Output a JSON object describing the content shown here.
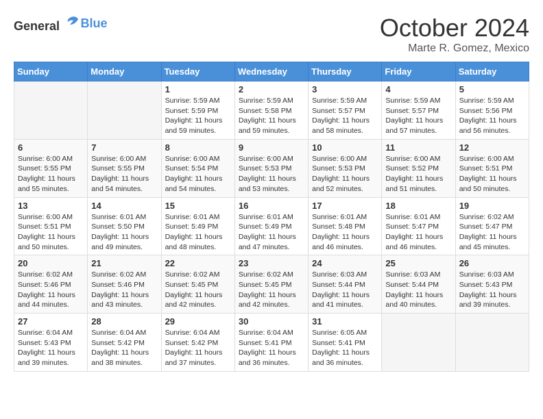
{
  "logo": {
    "general": "General",
    "blue": "Blue"
  },
  "title": {
    "month": "October 2024",
    "location": "Marte R. Gomez, Mexico"
  },
  "headers": [
    "Sunday",
    "Monday",
    "Tuesday",
    "Wednesday",
    "Thursday",
    "Friday",
    "Saturday"
  ],
  "weeks": [
    [
      {
        "day": "",
        "info": ""
      },
      {
        "day": "",
        "info": ""
      },
      {
        "day": "1",
        "info": "Sunrise: 5:59 AM\nSunset: 5:59 PM\nDaylight: 11 hours and 59 minutes."
      },
      {
        "day": "2",
        "info": "Sunrise: 5:59 AM\nSunset: 5:58 PM\nDaylight: 11 hours and 59 minutes."
      },
      {
        "day": "3",
        "info": "Sunrise: 5:59 AM\nSunset: 5:57 PM\nDaylight: 11 hours and 58 minutes."
      },
      {
        "day": "4",
        "info": "Sunrise: 5:59 AM\nSunset: 5:57 PM\nDaylight: 11 hours and 57 minutes."
      },
      {
        "day": "5",
        "info": "Sunrise: 5:59 AM\nSunset: 5:56 PM\nDaylight: 11 hours and 56 minutes."
      }
    ],
    [
      {
        "day": "6",
        "info": "Sunrise: 6:00 AM\nSunset: 5:55 PM\nDaylight: 11 hours and 55 minutes."
      },
      {
        "day": "7",
        "info": "Sunrise: 6:00 AM\nSunset: 5:55 PM\nDaylight: 11 hours and 54 minutes."
      },
      {
        "day": "8",
        "info": "Sunrise: 6:00 AM\nSunset: 5:54 PM\nDaylight: 11 hours and 54 minutes."
      },
      {
        "day": "9",
        "info": "Sunrise: 6:00 AM\nSunset: 5:53 PM\nDaylight: 11 hours and 53 minutes."
      },
      {
        "day": "10",
        "info": "Sunrise: 6:00 AM\nSunset: 5:53 PM\nDaylight: 11 hours and 52 minutes."
      },
      {
        "day": "11",
        "info": "Sunrise: 6:00 AM\nSunset: 5:52 PM\nDaylight: 11 hours and 51 minutes."
      },
      {
        "day": "12",
        "info": "Sunrise: 6:00 AM\nSunset: 5:51 PM\nDaylight: 11 hours and 50 minutes."
      }
    ],
    [
      {
        "day": "13",
        "info": "Sunrise: 6:00 AM\nSunset: 5:51 PM\nDaylight: 11 hours and 50 minutes."
      },
      {
        "day": "14",
        "info": "Sunrise: 6:01 AM\nSunset: 5:50 PM\nDaylight: 11 hours and 49 minutes."
      },
      {
        "day": "15",
        "info": "Sunrise: 6:01 AM\nSunset: 5:49 PM\nDaylight: 11 hours and 48 minutes."
      },
      {
        "day": "16",
        "info": "Sunrise: 6:01 AM\nSunset: 5:49 PM\nDaylight: 11 hours and 47 minutes."
      },
      {
        "day": "17",
        "info": "Sunrise: 6:01 AM\nSunset: 5:48 PM\nDaylight: 11 hours and 46 minutes."
      },
      {
        "day": "18",
        "info": "Sunrise: 6:01 AM\nSunset: 5:47 PM\nDaylight: 11 hours and 46 minutes."
      },
      {
        "day": "19",
        "info": "Sunrise: 6:02 AM\nSunset: 5:47 PM\nDaylight: 11 hours and 45 minutes."
      }
    ],
    [
      {
        "day": "20",
        "info": "Sunrise: 6:02 AM\nSunset: 5:46 PM\nDaylight: 11 hours and 44 minutes."
      },
      {
        "day": "21",
        "info": "Sunrise: 6:02 AM\nSunset: 5:46 PM\nDaylight: 11 hours and 43 minutes."
      },
      {
        "day": "22",
        "info": "Sunrise: 6:02 AM\nSunset: 5:45 PM\nDaylight: 11 hours and 42 minutes."
      },
      {
        "day": "23",
        "info": "Sunrise: 6:02 AM\nSunset: 5:45 PM\nDaylight: 11 hours and 42 minutes."
      },
      {
        "day": "24",
        "info": "Sunrise: 6:03 AM\nSunset: 5:44 PM\nDaylight: 11 hours and 41 minutes."
      },
      {
        "day": "25",
        "info": "Sunrise: 6:03 AM\nSunset: 5:44 PM\nDaylight: 11 hours and 40 minutes."
      },
      {
        "day": "26",
        "info": "Sunrise: 6:03 AM\nSunset: 5:43 PM\nDaylight: 11 hours and 39 minutes."
      }
    ],
    [
      {
        "day": "27",
        "info": "Sunrise: 6:04 AM\nSunset: 5:43 PM\nDaylight: 11 hours and 39 minutes."
      },
      {
        "day": "28",
        "info": "Sunrise: 6:04 AM\nSunset: 5:42 PM\nDaylight: 11 hours and 38 minutes."
      },
      {
        "day": "29",
        "info": "Sunrise: 6:04 AM\nSunset: 5:42 PM\nDaylight: 11 hours and 37 minutes."
      },
      {
        "day": "30",
        "info": "Sunrise: 6:04 AM\nSunset: 5:41 PM\nDaylight: 11 hours and 36 minutes."
      },
      {
        "day": "31",
        "info": "Sunrise: 6:05 AM\nSunset: 5:41 PM\nDaylight: 11 hours and 36 minutes."
      },
      {
        "day": "",
        "info": ""
      },
      {
        "day": "",
        "info": ""
      }
    ]
  ]
}
